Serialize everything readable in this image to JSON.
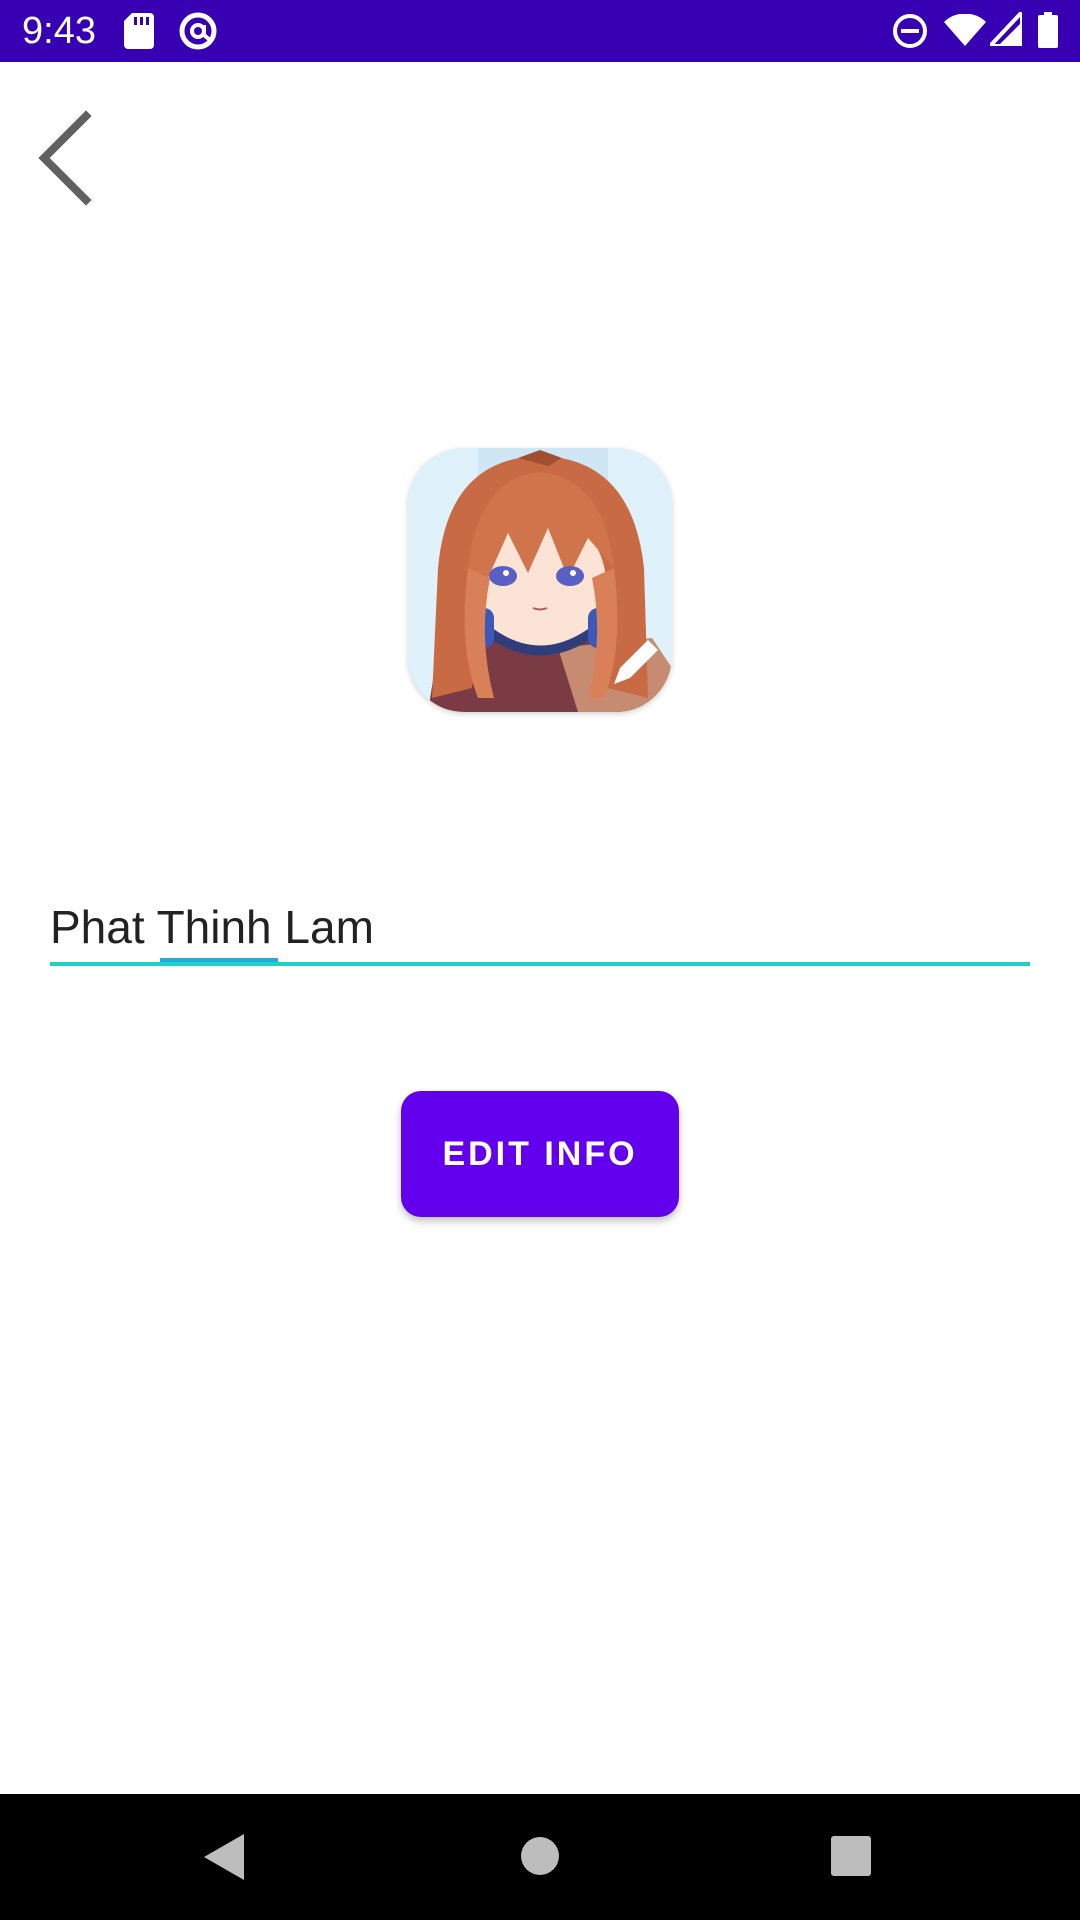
{
  "status_bar": {
    "time": "9:43",
    "background": "#3700b3",
    "icons_left": [
      "sd-card-icon",
      "at-sign-icon"
    ],
    "icons_right": [
      "do-not-disturb-icon",
      "wifi-icon",
      "cell-signal-icon",
      "battery-icon"
    ]
  },
  "profile": {
    "avatar_icon": "avatar-image",
    "edit_avatar_icon": "pencil-icon",
    "name_value": "Phat Thinh Lam"
  },
  "actions": {
    "edit_info_label": "EDIT INFO"
  },
  "colors": {
    "accent": "#6200ee",
    "field_underline": "#1fd1c4",
    "spellcheck": "#2aa6e0"
  },
  "navigation": {
    "back_icon": "chevron-left-icon",
    "system_buttons": [
      "back-triangle-icon",
      "home-circle-icon",
      "recents-square-icon"
    ]
  }
}
